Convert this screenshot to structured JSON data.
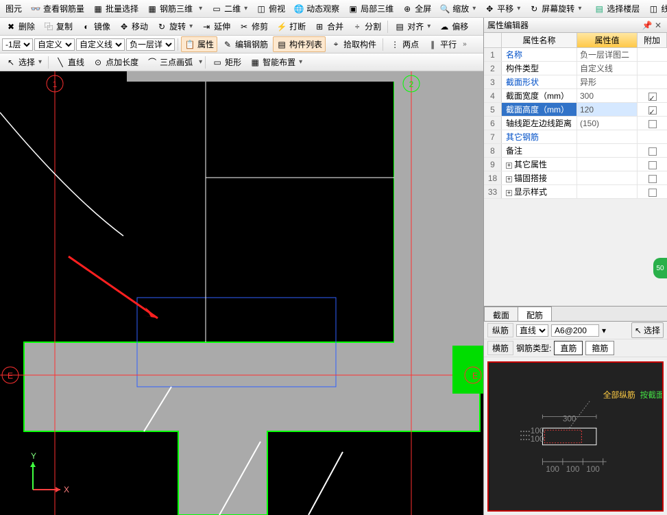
{
  "toolbar1": {
    "tuyuan": "图元",
    "ckgj": "查看钢筋量",
    "plxz": "批量选择",
    "gjsw": "钢筋三维",
    "erwei": "二维",
    "fushi": "俯视",
    "dtgc": "动态观察",
    "jbsw": "局部三维",
    "qp": "全屏",
    "sf": "缩放",
    "py": "平移",
    "pmxz": "屏幕旋转",
    "xzlc": "选择楼层",
    "xk": "线框"
  },
  "toolbar2": {
    "shanchu": "删除",
    "fuzhi": "复制",
    "jingxiang": "镜像",
    "yidong": "移动",
    "xuanzhuan": "旋转",
    "yanshen": "延伸",
    "xiujian": "修剪",
    "daduan": "打断",
    "hebing": "合并",
    "fenge": "分割",
    "duiqi": "对齐",
    "pianyi": "偏移"
  },
  "toolbar3": {
    "floor": "-1层",
    "zdy": "自定义",
    "zdyx": "自定义线",
    "fycx": "负一层详",
    "shuxing": "属性",
    "bjgj": "编辑钢筋",
    "gjlb": "构件列表",
    "sqgj": "拾取构件",
    "liangdian": "两点",
    "pingxing": "平行"
  },
  "toolbar4": {
    "xuanze": "选择",
    "zhixian": "直线",
    "djcd": "点加长度",
    "sdhh": "三点画弧",
    "juxing": "矩形",
    "znbz": "智能布置"
  },
  "propPanel": {
    "title": "属性编辑器",
    "h_name": "属性名称",
    "h_val": "属性值",
    "h_add": "附加",
    "rows": [
      {
        "n": "1",
        "k": "名称",
        "v": "负一层详图二",
        "blue": true,
        "chk": ""
      },
      {
        "n": "2",
        "k": "构件类型",
        "v": "自定义线",
        "blue": false,
        "chk": ""
      },
      {
        "n": "3",
        "k": "截面形状",
        "v": "异形",
        "blue": true,
        "chk": ""
      },
      {
        "n": "4",
        "k": "截面宽度（mm）",
        "v": "300",
        "blue": false,
        "chk": "on"
      },
      {
        "n": "5",
        "k": "截面高度（mm）",
        "v": "120",
        "blue": true,
        "chk": "on",
        "sel": true
      },
      {
        "n": "6",
        "k": "轴线距左边线距离",
        "v": "(150)",
        "blue": false,
        "chk": "off"
      },
      {
        "n": "7",
        "k": "其它钢筋",
        "v": "",
        "blue": true,
        "chk": ""
      },
      {
        "n": "8",
        "k": "备注",
        "v": "",
        "blue": false,
        "chk": "off"
      },
      {
        "n": "9",
        "k": "其它属性",
        "v": "",
        "blue": false,
        "exp": true
      },
      {
        "n": "18",
        "k": "锚固搭接",
        "v": "",
        "blue": false,
        "exp": true
      },
      {
        "n": "33",
        "k": "显示样式",
        "v": "",
        "blue": false,
        "exp": true
      }
    ]
  },
  "rebarPanel": {
    "tab1": "截面",
    "tab2": "配筋",
    "zongjin": "纵筋",
    "zhixian": "直线",
    "spec": "A6@200",
    "xuanze": "选择",
    "hengjin": "横筋",
    "gjlx": "钢筋类型:",
    "zj": "直筋",
    "gj": "箍筋",
    "qbjj": "全部纵筋",
    "ajm": "按截面"
  },
  "preview_dims": {
    "w": "300",
    "h1": "100",
    "h2": "100",
    "h3": "100"
  },
  "badge": "50",
  "axis": {
    "x": "X",
    "y": "Y"
  }
}
